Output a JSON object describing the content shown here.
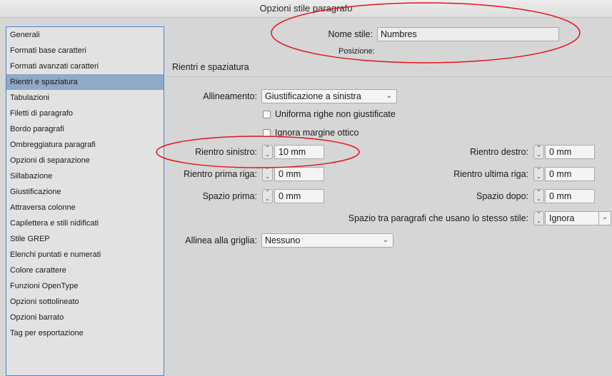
{
  "window": {
    "title": "Opzioni stile paragrafo"
  },
  "sidebar": {
    "items": [
      {
        "label": "Generali"
      },
      {
        "label": "Formati base caratteri"
      },
      {
        "label": "Formati avanzati caratteri"
      },
      {
        "label": "Rientri e spaziatura",
        "selected": true
      },
      {
        "label": "Tabulazioni"
      },
      {
        "label": "Filetti di paragrafo"
      },
      {
        "label": "Bordo paragrafi"
      },
      {
        "label": "Ombreggiatura paragrafi"
      },
      {
        "label": "Opzioni di separazione"
      },
      {
        "label": "Sillabazione"
      },
      {
        "label": "Giustificazione"
      },
      {
        "label": "Attraversa colonne"
      },
      {
        "label": "Capilettera e stili nidificati"
      },
      {
        "label": "Stile GREP"
      },
      {
        "label": "Elenchi puntati e numerati"
      },
      {
        "label": "Colore carattere"
      },
      {
        "label": "Funzioni OpenType"
      },
      {
        "label": "Opzioni sottolineato"
      },
      {
        "label": "Opzioni barrato"
      },
      {
        "label": "Tag per esportazione"
      }
    ]
  },
  "header": {
    "style_name_label": "Nome stile:",
    "style_name_value": "Numbres",
    "position_label": "Posizione:"
  },
  "section": {
    "title": "Rientri e spaziatura"
  },
  "form": {
    "alignment_label": "Allineamento:",
    "alignment_value": "Giustificazione a sinistra",
    "balance_lines_label": "Uniforma righe non giustificate",
    "balance_lines_checked": false,
    "ignore_optical_label": "Ignora margine ottico",
    "ignore_optical_checked": false,
    "left_indent_label": "Rientro sinistro:",
    "left_indent_value": "10 mm",
    "right_indent_label": "Rientro destro:",
    "right_indent_value": "0 mm",
    "first_line_indent_label": "Rientro prima riga:",
    "first_line_indent_value": "0 mm",
    "last_line_indent_label": "Rientro ultima riga:",
    "last_line_indent_value": "0 mm",
    "space_before_label": "Spazio prima:",
    "space_before_value": "0 mm",
    "space_after_label": "Spazio dopo:",
    "space_after_value": "0 mm",
    "same_style_spacing_label": "Spazio tra paragrafi che usano lo stesso stile:",
    "same_style_spacing_value": "Ignora",
    "align_grid_label": "Allinea alla griglia:",
    "align_grid_value": "Nessuno"
  },
  "icons": {
    "spinner": "stepper-up-down-icon",
    "dropdown": "chevron-down-icon"
  },
  "colors": {
    "selected_item": "#8fa9c7",
    "sidebar_border": "#4a86d4",
    "annotation_red": "#e0141a"
  }
}
